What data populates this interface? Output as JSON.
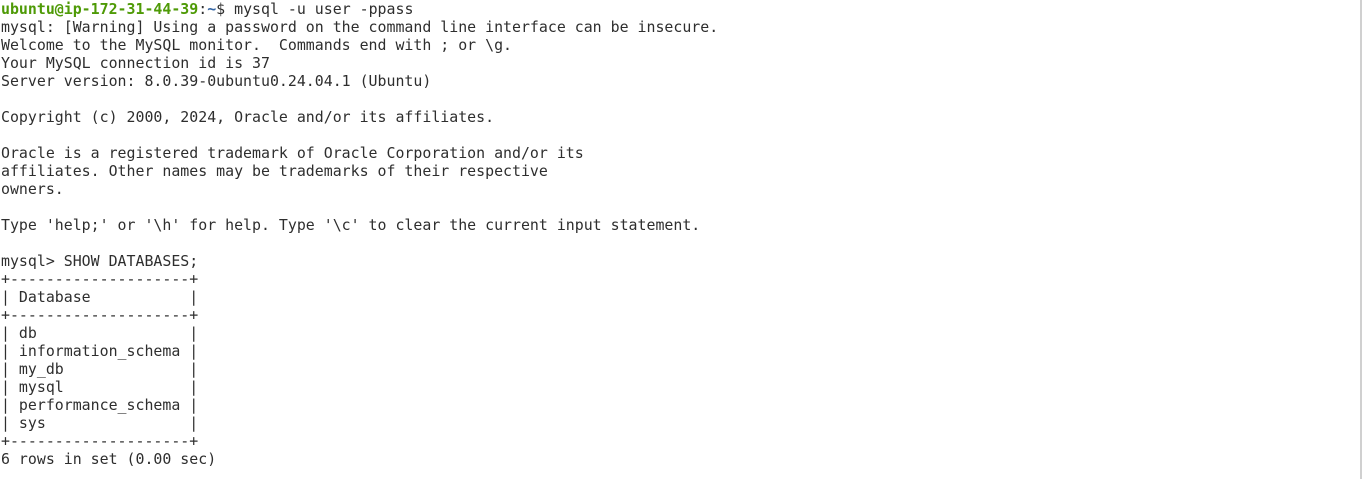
{
  "prompt": {
    "user_host": "ubuntu@ip-172-31-44-39",
    "colon": ":",
    "path": "~",
    "symbol": "$ ",
    "command": "mysql -u user -ppass"
  },
  "lines": [
    "mysql: [Warning] Using a password on the command line interface can be insecure.",
    "Welcome to the MySQL monitor.  Commands end with ; or \\g.",
    "Your MySQL connection id is 37",
    "Server version: 8.0.39-0ubuntu0.24.04.1 (Ubuntu)",
    "",
    "Copyright (c) 2000, 2024, Oracle and/or its affiliates.",
    "",
    "Oracle is a registered trademark of Oracle Corporation and/or its",
    "affiliates. Other names may be trademarks of their respective",
    "owners.",
    "",
    "Type 'help;' or '\\h' for help. Type '\\c' to clear the current input statement.",
    "",
    "mysql> SHOW DATABASES;",
    "+--------------------+",
    "| Database           |",
    "+--------------------+",
    "| db                 |",
    "| information_schema |",
    "| my_db              |",
    "| mysql              |",
    "| performance_schema |",
    "| sys                |",
    "+--------------------+",
    "6 rows in set (0.00 sec)"
  ]
}
